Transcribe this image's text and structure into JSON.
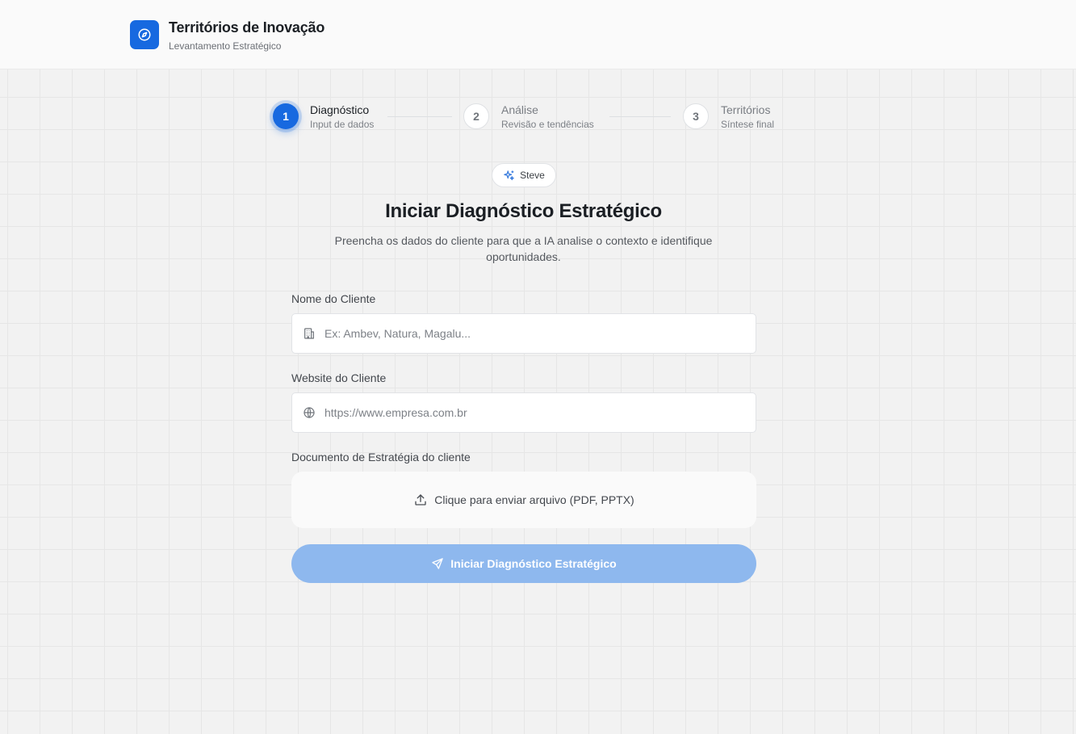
{
  "header": {
    "title": "Territórios de Inovação",
    "subtitle": "Levantamento Estratégico",
    "logo_icon": "compass-icon",
    "accent_color": "#1769e0"
  },
  "stepper": {
    "current_step": 1,
    "steps": [
      {
        "number": "1",
        "label": "Diagnóstico",
        "description": "Input de dados",
        "state": "active"
      },
      {
        "number": "2",
        "label": "Análise",
        "description": "Revisão e tendências",
        "state": "pending"
      },
      {
        "number": "3",
        "label": "Territórios",
        "description": "Síntese final",
        "state": "pending"
      }
    ]
  },
  "agent": {
    "name": "Steve",
    "icon": "sparkles-icon"
  },
  "main": {
    "title": "Iniciar Diagnóstico Estratégico",
    "description": "Preencha os dados do cliente para que a IA analise o contexto e identifique oportunidades."
  },
  "form": {
    "client_name": {
      "label": "Nome do Cliente",
      "placeholder": "Ex: Ambev, Natura, Magalu...",
      "value": "",
      "icon": "building-icon"
    },
    "client_website": {
      "label": "Website do Cliente",
      "placeholder": "https://www.empresa.com.br",
      "value": "",
      "icon": "globe-icon"
    },
    "strategy_document": {
      "label": "Documento de Estratégia do cliente",
      "upload_text": "Clique para enviar arquivo (PDF, PPTX)",
      "icon": "upload-icon"
    },
    "submit": {
      "label": "Iniciar Diagnóstico Estratégico",
      "icon": "send-icon",
      "disabled": true,
      "color": "#8eb8ee"
    }
  }
}
